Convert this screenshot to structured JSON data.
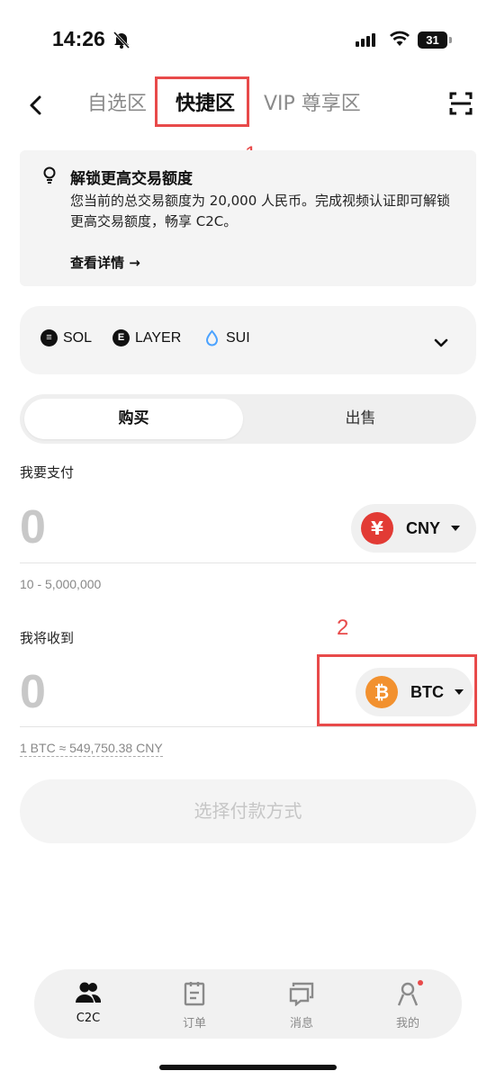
{
  "status_bar": {
    "time": "14:26",
    "battery": "31"
  },
  "header": {
    "tabs": [
      {
        "label": "自选区",
        "active": false
      },
      {
        "label": "快捷区",
        "active": true
      },
      {
        "label": "VIP 尊享区",
        "active": false
      }
    ]
  },
  "annotations": {
    "one": "1",
    "two": "2",
    "color": "#e84a4a"
  },
  "notice": {
    "title": "解锁更高交易额度",
    "body": "您当前的总交易额度为 20,000 人民币。完成视频认证即可解锁更高交易额度，畅享 C2C。",
    "link": "查看详情 →"
  },
  "tokens": [
    {
      "symbol": "SOL",
      "icon": "sol-icon"
    },
    {
      "symbol": "LAYER",
      "icon": "layer-icon"
    },
    {
      "symbol": "SUI",
      "icon": "sui-icon"
    }
  ],
  "trade": {
    "buy_label": "购买",
    "sell_label": "出售",
    "pay_label": "我要支付",
    "pay_amount": "0",
    "pay_currency": "CNY",
    "pay_range": "10 - 5,000,000",
    "receive_label": "我将收到",
    "receive_amount": "0",
    "receive_currency": "BTC",
    "rate": "1 BTC ≈ 549,750.38 CNY",
    "cta": "选择付款方式"
  },
  "bottom_nav": [
    {
      "label": "C2C",
      "icon": "people-icon",
      "active": true
    },
    {
      "label": "订单",
      "icon": "clipboard-icon",
      "active": false
    },
    {
      "label": "消息",
      "icon": "chat-icon",
      "active": false
    },
    {
      "label": "我的",
      "icon": "person-icon",
      "active": false
    }
  ],
  "colors": {
    "cny": "#e23b35",
    "btc": "#f2912f",
    "sui": "#4ca3ff"
  }
}
